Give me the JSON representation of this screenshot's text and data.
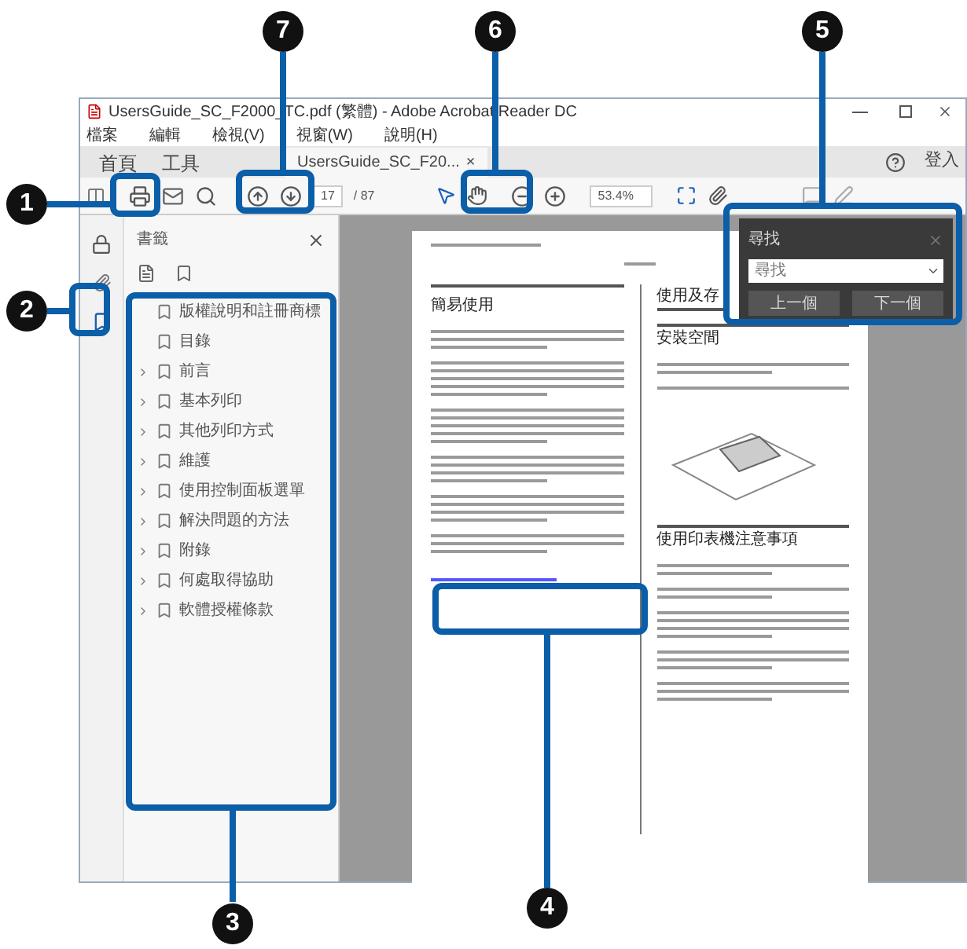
{
  "window": {
    "title": "UsersGuide_SC_F2000_TC.pdf (繁體) - Adobe Acrobat Reader DC"
  },
  "menu": [
    "檔案",
    "編輯",
    "檢視(V)",
    "視窗(W)",
    "說明(H)"
  ],
  "tabs": [
    {
      "label": "首頁",
      "kind": "nav",
      "selected": false
    },
    {
      "label": "工具",
      "kind": "nav",
      "selected": false
    },
    {
      "label": "UsersGuide_SC_F20...",
      "kind": "document",
      "selected": true,
      "close": "×"
    }
  ],
  "sign_in": "登入",
  "toolbar": {
    "page": "17",
    "page_total": "/ 87",
    "zoom": "53.4%"
  },
  "bookmarks": {
    "title": "書籤",
    "items": [
      {
        "label": "版權說明和註冊商標",
        "expandable": false
      },
      {
        "label": "目錄",
        "expandable": false
      },
      {
        "label": "前言",
        "expandable": true
      },
      {
        "label": "基本列印",
        "expandable": true
      },
      {
        "label": "其他列印方式",
        "expandable": true
      },
      {
        "label": "維護",
        "expandable": true
      },
      {
        "label": "使用控制面板選單",
        "expandable": true
      },
      {
        "label": "解決問題的方法",
        "expandable": true
      },
      {
        "label": "附錄",
        "expandable": true
      },
      {
        "label": "何處取得協助",
        "expandable": true
      },
      {
        "label": "軟體授權條款",
        "expandable": true
      }
    ]
  },
  "document": {
    "left_heading": "簡易使用",
    "right_heading": "使用及存",
    "sub_heading": "安裝空間",
    "section_heading": "使用印表機注意事項"
  },
  "find": {
    "title": "尋找",
    "placeholder": "尋找",
    "buttons": [
      "上一個",
      "下一個"
    ]
  },
  "callouts": [
    "7",
    "6",
    "5",
    "1",
    "2",
    "3",
    "4"
  ]
}
